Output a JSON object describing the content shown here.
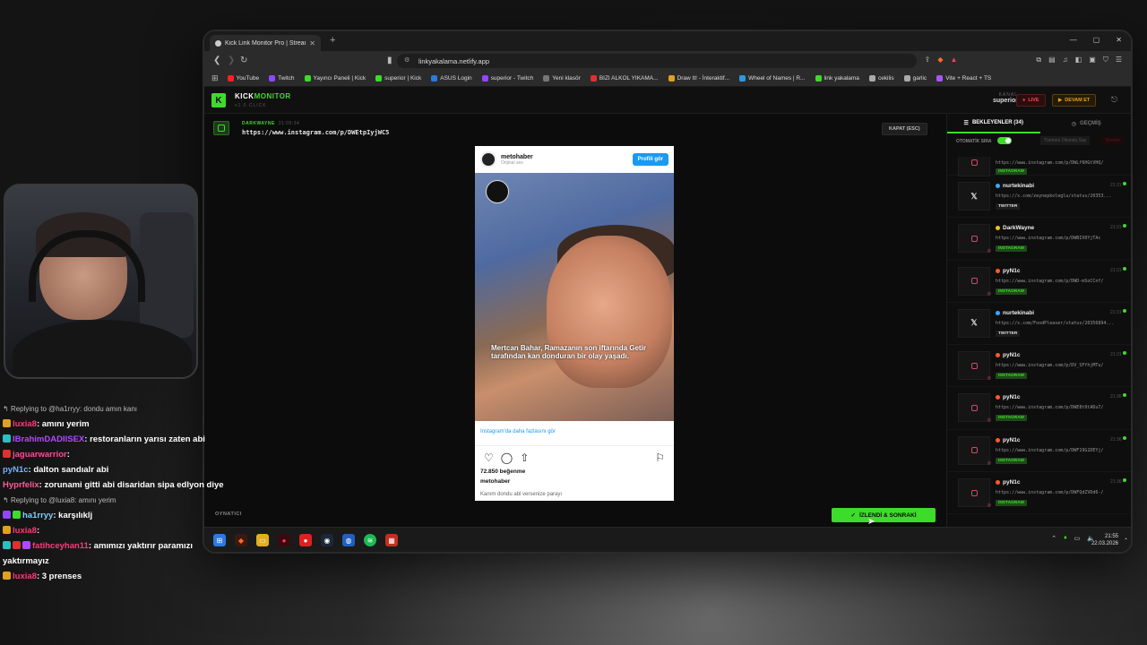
{
  "browser": {
    "tab_title": "Kick Link Monitor Pro | Stream",
    "url": "linkyakalama.netlify.app",
    "bookmarks": [
      {
        "label": "YouTube",
        "color": "#ff2020"
      },
      {
        "label": "Twitch",
        "color": "#9146ff"
      },
      {
        "label": "Yayıncı Paneli | Kick",
        "color": "#3ddc2a"
      },
      {
        "label": "superior | Kick",
        "color": "#3ddc2a"
      },
      {
        "label": "ASUS Login",
        "color": "#2a7ae0"
      },
      {
        "label": "superior - Twitch",
        "color": "#9146ff"
      },
      {
        "label": "Yeni klasör",
        "color": "#777777"
      },
      {
        "label": "BIZI ALKOL YIKAMA...",
        "color": "#e03030"
      },
      {
        "label": "Draw It! - İnteraktif...",
        "color": "#e0a020"
      },
      {
        "label": "Wheel of Names | R...",
        "color": "#2a9ae0"
      },
      {
        "label": "link yakalama",
        "color": "#3ddc2a"
      },
      {
        "label": "cekilis",
        "color": "#aaaaaa"
      },
      {
        "label": "garlic",
        "color": "#aaaaaa"
      },
      {
        "label": "Vite + React + TS",
        "color": "#a855f7"
      }
    ]
  },
  "app": {
    "brand_white": "KICK",
    "brand_green": "MONITOR",
    "brand_sub": "v1.0 CLICK",
    "kanal_label": "KANAL",
    "kanal_name": "superior",
    "live_label": "LIVE",
    "devam_label": "DEVAM ET",
    "current_link": {
      "user": "DARKWAYNE",
      "time": "21:09:34",
      "url": "https://www.instagram.com/p/DWEtpIyjWC5"
    },
    "close_label": "KAPAT (ESC)",
    "player_label": "OYNATICI",
    "watched_button": "İZLENDİ & SONRAKİ"
  },
  "embed": {
    "username": "metohaber",
    "audio": "Orijinal ses",
    "profile_button": "Profili gör",
    "caption": "Mertcan Bahar, Ramazanın son iftarında Getir tarafından kan donduran bir olay yaşadı.",
    "more_link": "Instagram'da daha fazlasını gör",
    "likes": "72.850 beğenme",
    "owner": "metohaber",
    "comment": "Kanım dondu abi versenize parayı"
  },
  "queue": {
    "tab_waiting": "BEKLEYENLER (34)",
    "tab_history": "GEÇMİŞ",
    "auto_label": "OTOMATİK SIRA",
    "btn_mark_all": "Tümünü Okundu Say",
    "btn_clear": "Temizle",
    "top_item": {
      "url": "https://www.instagram.com/p/DWLf6HGtVHQ/",
      "badge": "INSTAGRAM"
    },
    "items": [
      {
        "user": "nurtekinabi",
        "dot": "#3aa7ff",
        "time": "21:31",
        "url": "https://x.com/zeynepkoleglu/status/20353...",
        "badge": "TWITTER",
        "type": "x"
      },
      {
        "user": "DarkWayne",
        "dot": "#f2c21a",
        "time": "21:31",
        "url": "https://www.instagram.com/p/DWBIX0YjTAc",
        "badge": "INSTAGRAM",
        "type": "ig"
      },
      {
        "user": "pyN1c",
        "dot": "#ff5a2a",
        "time": "21:31",
        "url": "https://www.instagram.com/p/DWD-mSoCCnf/",
        "badge": "INSTAGRAM",
        "type": "ig"
      },
      {
        "user": "nurtekinabi",
        "dot": "#3aa7ff",
        "time": "21:31",
        "url": "https://x.com/FoodPleaser/status/20356894...",
        "badge": "TWITTER",
        "type": "x"
      },
      {
        "user": "pyN1c",
        "dot": "#ff5a2a",
        "time": "21:31",
        "url": "https://www.instagram.com/p/DV_SFfhjMTu/",
        "badge": "INSTAGRAM",
        "type": "ig"
      },
      {
        "user": "pyN1c",
        "dot": "#ff5a2a",
        "time": "21:36",
        "url": "https://www.instagram.com/p/DWE8t0tADu7/",
        "badge": "INSTAGRAM",
        "type": "ig"
      },
      {
        "user": "pyN1c",
        "dot": "#ff5a2a",
        "time": "21:36",
        "url": "https://www.instagram.com/p/DWF19G1DEYj/",
        "badge": "INSTAGRAM",
        "type": "ig"
      },
      {
        "user": "pyN1c",
        "dot": "#ff5a2a",
        "time": "21:36",
        "url": "https://www.instagram.com/p/DWFQdZVDd6-/",
        "badge": "INSTAGRAM",
        "type": "ig"
      }
    ]
  },
  "taskbar": {
    "time": "21:55",
    "date": "22.03.2026"
  },
  "chat": [
    {
      "kind": "reply",
      "text": "Replying to @ha1rryy: dondu amın kanı"
    },
    {
      "kind": "msg",
      "user": "luxia8",
      "color": "#ff3a7a",
      "badges": [
        "#e0a020"
      ],
      "text": "amını yerim"
    },
    {
      "kind": "msg",
      "user": "IBrahimDADIlSEX",
      "color": "#b04aff",
      "badges": [
        "#2ac0c0"
      ],
      "text": "restoranların yarısı zaten abi"
    },
    {
      "kind": "msg",
      "user": "jaguarwarrior",
      "color": "#ff4a9a",
      "badges": [
        "#e03030"
      ],
      "text": ""
    },
    {
      "kind": "msg",
      "user": "pyN1c",
      "color": "#7ab0ff",
      "badges": [],
      "text": "dalton sandıalr abi"
    },
    {
      "kind": "msg",
      "user": "Hyprfelix",
      "color": "#ff5a9a",
      "badges": [],
      "text": "zorunami gitti abi disaridan sipa edlyon diye"
    },
    {
      "kind": "reply",
      "text": "Replying to @luxia8: amını yerim"
    },
    {
      "kind": "msg",
      "user": "ha1rryy",
      "color": "#7ad0ff",
      "badges": [
        "#9146ff",
        "#3ddc2a"
      ],
      "text": "karşılıklj"
    },
    {
      "kind": "msg",
      "user": "luxia8",
      "color": "#ff3a7a",
      "badges": [
        "#e0a020"
      ],
      "text": ""
    },
    {
      "kind": "msg",
      "user": "fatihceyhan11",
      "color": "#ff3a7a",
      "badges": [
        "#2ac0c0",
        "#e03030",
        "#b04aff"
      ],
      "text": "amımızı yaktırır paramızı yaktırmayız"
    },
    {
      "kind": "msg",
      "user": "luxia8",
      "color": "#ff3a7a",
      "badges": [
        "#e0a020"
      ],
      "text": "3 prenses"
    }
  ]
}
